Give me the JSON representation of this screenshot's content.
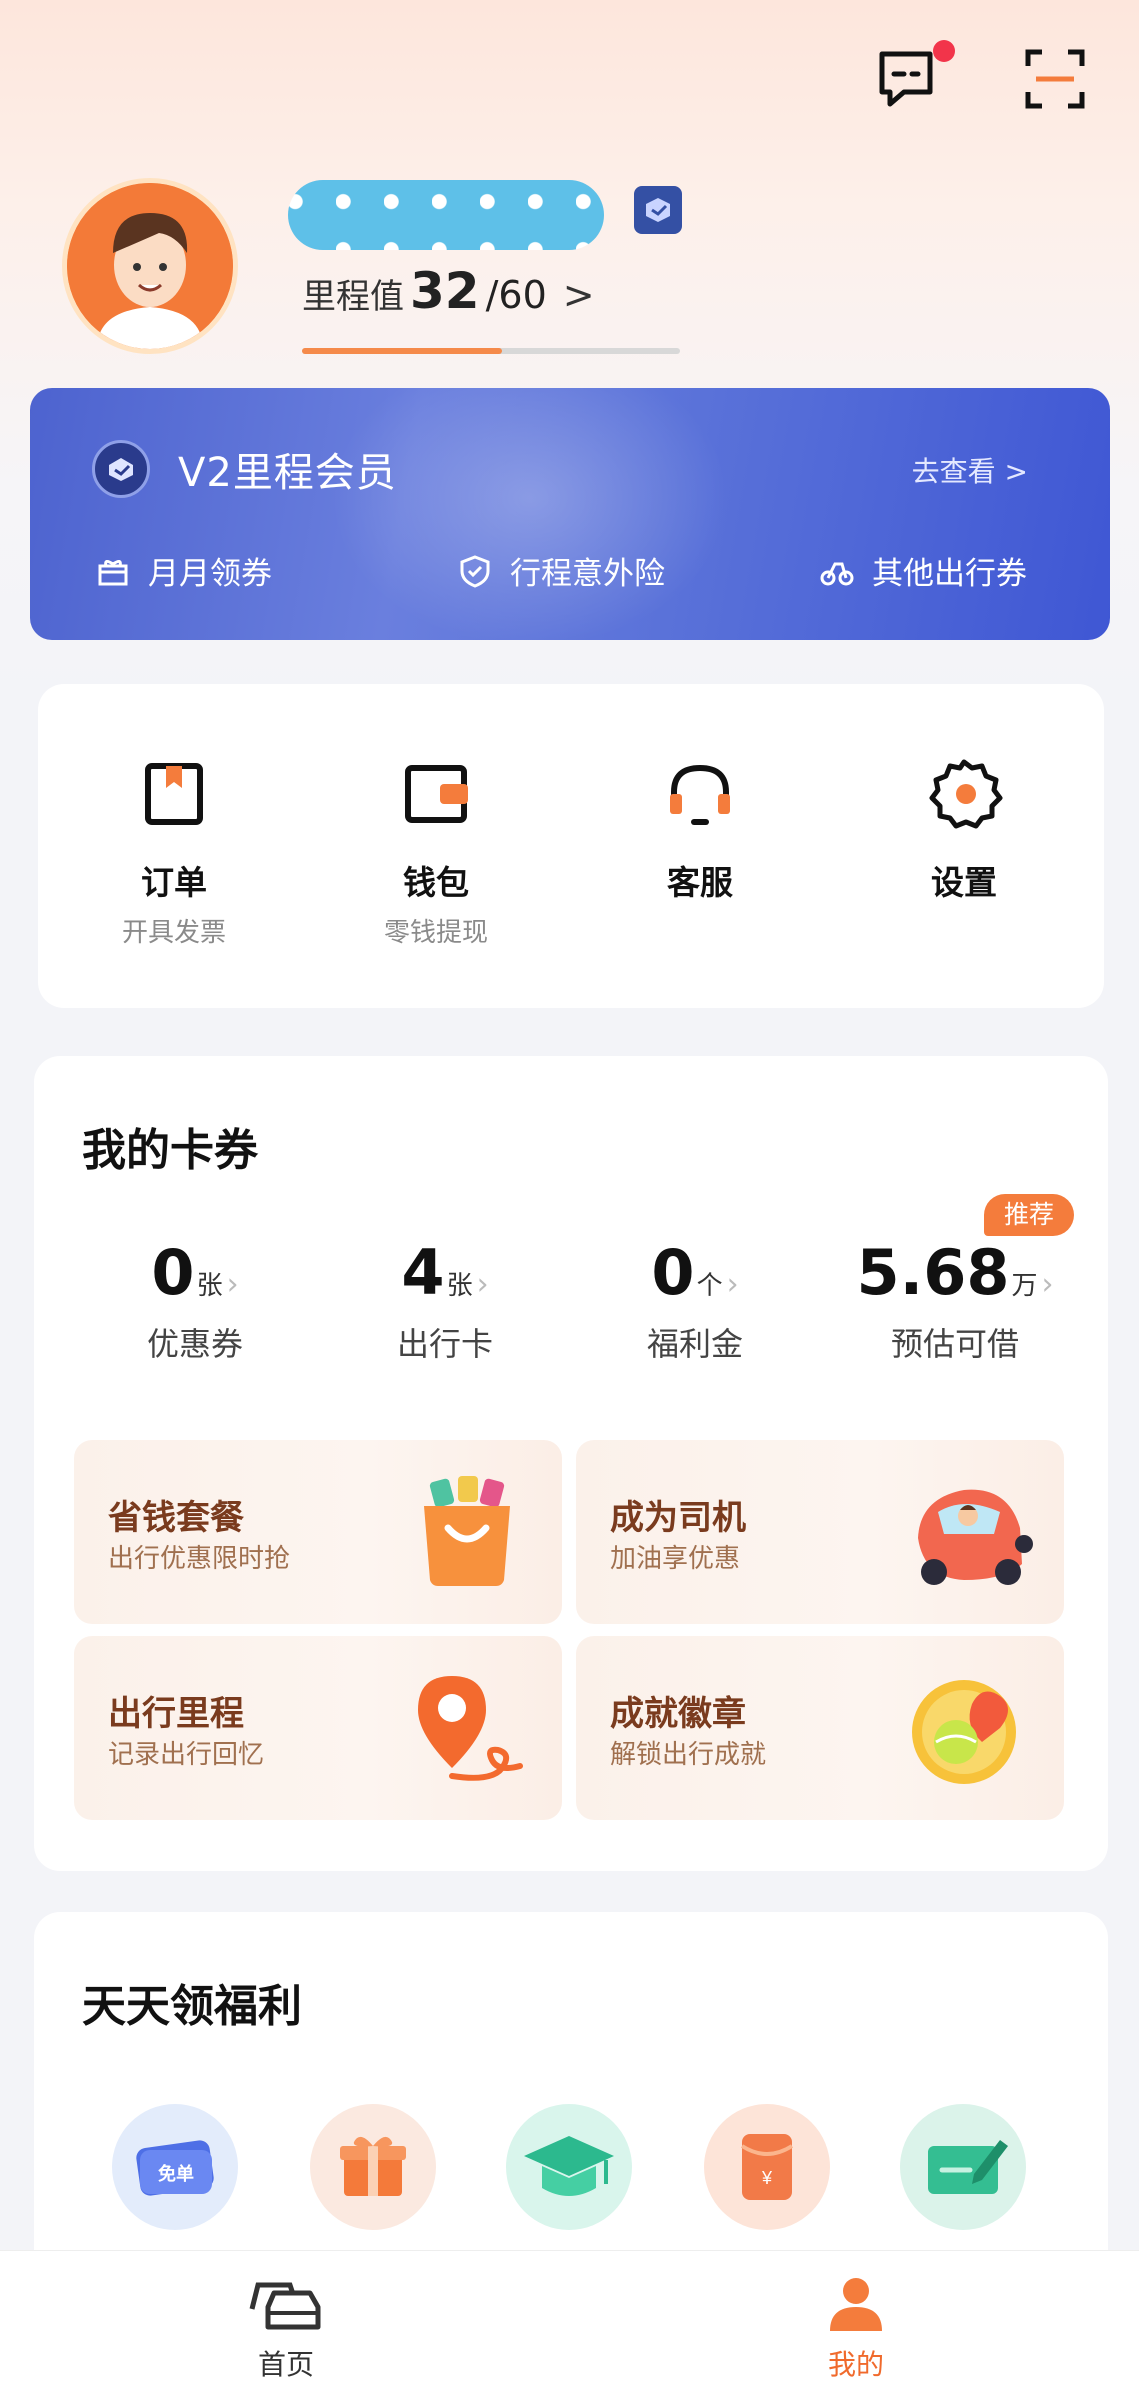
{
  "header": {
    "mileage_label": "里程值",
    "mileage_value": "32",
    "mileage_total": "/60",
    "mileage_arrow": ">",
    "mileage_progress": 0.53
  },
  "vip": {
    "title": "V2里程会员",
    "more": "去查看 >",
    "features": [
      "月月领券",
      "行程意外险",
      "其他出行券"
    ]
  },
  "quick_actions": [
    {
      "title": "订单",
      "sub": "开具发票",
      "icon": "order-icon"
    },
    {
      "title": "钱包",
      "sub": "零钱提现",
      "icon": "wallet-icon"
    },
    {
      "title": "客服",
      "sub": "",
      "icon": "headset-icon"
    },
    {
      "title": "设置",
      "sub": "",
      "icon": "gear-icon"
    }
  ],
  "cards": {
    "title": "我的卡券",
    "recommend_badge": "推荐",
    "stats": [
      {
        "value": "0",
        "unit": "张",
        "label": "优惠券"
      },
      {
        "value": "4",
        "unit": "张",
        "label": "出行卡"
      },
      {
        "value": "0",
        "unit": "个",
        "label": "福利金"
      },
      {
        "value": "5.68",
        "unit": "万",
        "label": "预估可借"
      }
    ],
    "tiles": [
      {
        "title": "省钱套餐",
        "sub": "出行优惠限时抢",
        "icon": "shopping-bag-icon"
      },
      {
        "title": "成为司机",
        "sub": "加油享优惠",
        "icon": "driver-car-icon"
      },
      {
        "title": "出行里程",
        "sub": "记录出行回忆",
        "icon": "location-pin-icon"
      },
      {
        "title": "成就徽章",
        "sub": "解锁出行成就",
        "icon": "medal-icon"
      }
    ]
  },
  "welfare": {
    "title": "天天领福利",
    "icons": [
      "free-ticket-icon",
      "gift-box-icon",
      "graduation-cap-icon",
      "red-envelope-icon",
      "check-signing-icon"
    ],
    "free_ticket_text": "免单"
  },
  "nav": {
    "home": "首页",
    "mine": "我的"
  },
  "colors": {
    "accent": "#f47c3c",
    "vip_blue": "#4d63cf"
  }
}
